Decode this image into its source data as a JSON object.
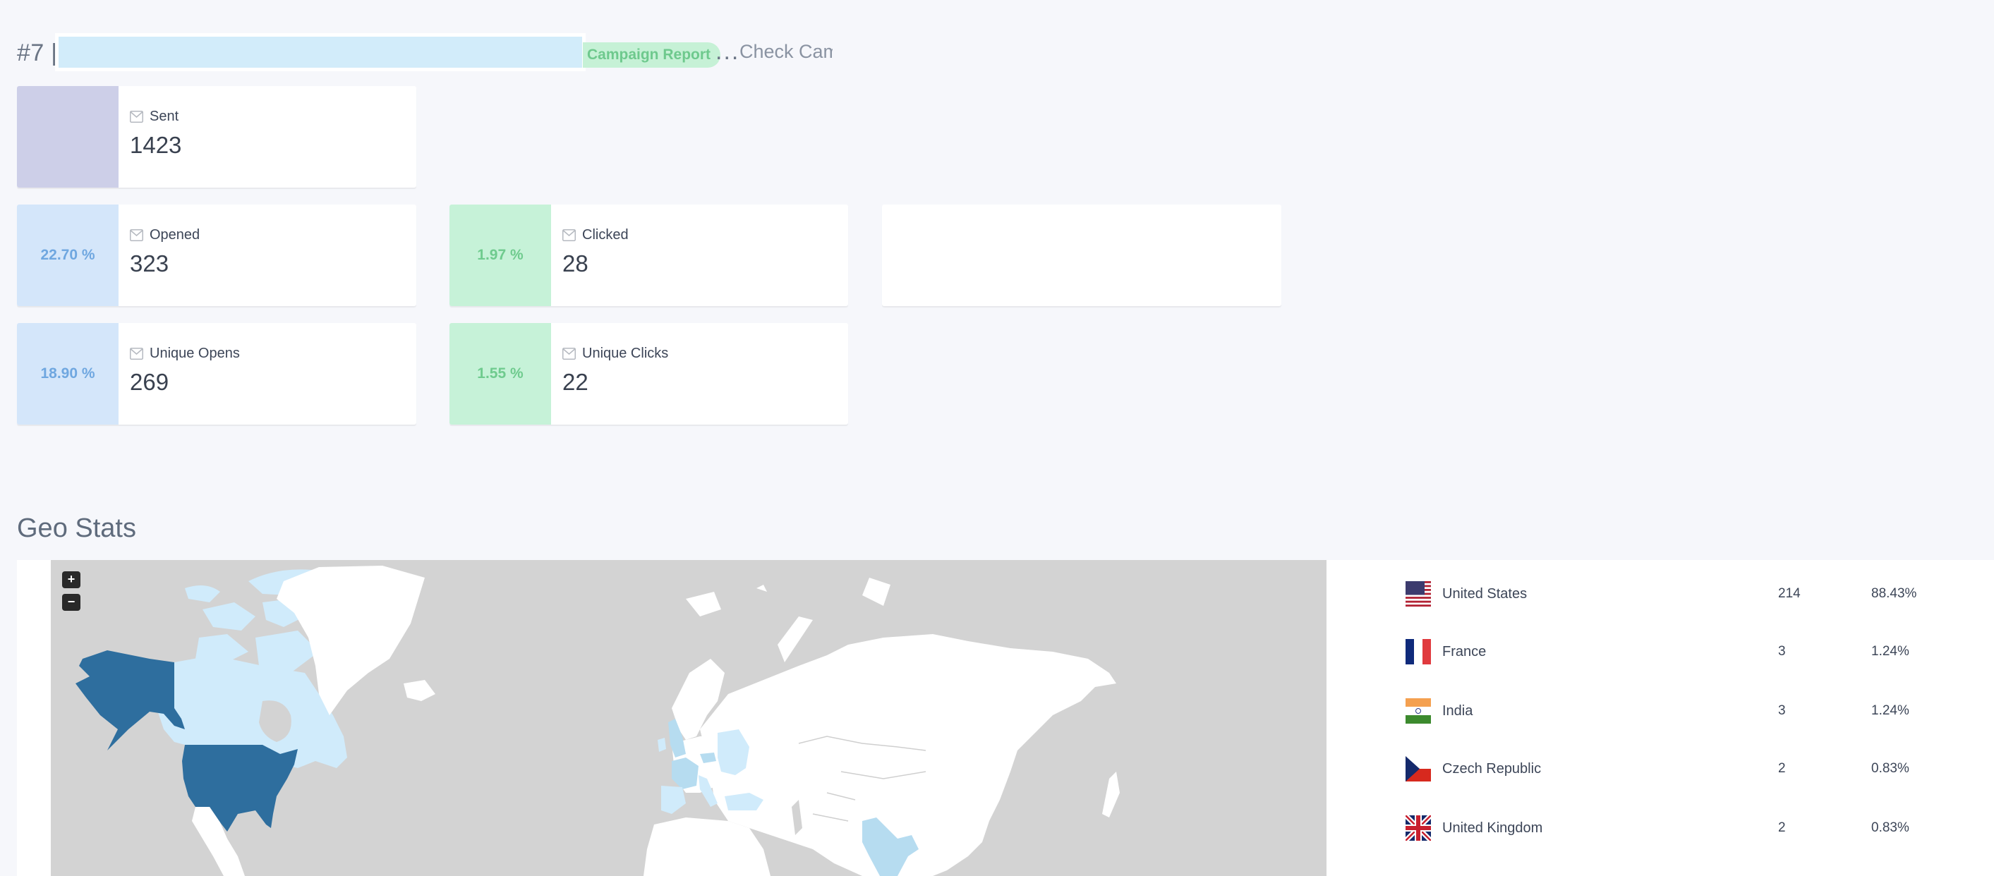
{
  "header": {
    "title_prefix": "#7 [",
    "badge": "Campaign Report",
    "more": "...",
    "check_link": "Check Campaign"
  },
  "stats": {
    "sent": {
      "label": "Sent",
      "value": "1423",
      "icon": "envelope-icon"
    },
    "opened": {
      "label": "Opened",
      "value": "323",
      "rate": "22.70 %",
      "icon": "envelope-icon"
    },
    "clicked": {
      "label": "Clicked",
      "value": "28",
      "rate": "1.97 %",
      "icon": "envelope-icon"
    },
    "unique_opens": {
      "label": "Unique Opens",
      "value": "269",
      "rate": "18.90 %",
      "icon": "envelope-icon"
    },
    "unique_clicks": {
      "label": "Unique Clicks",
      "value": "22",
      "rate": "1.55 %",
      "icon": "envelope-icon"
    }
  },
  "colors": {
    "sent_accent": "#cdcfe8",
    "open_accent": "#d4e6fa",
    "open_text": "#6fa7e0",
    "click_accent": "#c6f2d8",
    "click_text": "#6fcb8e",
    "map_high": "#2e6e9e",
    "map_mid": "#b6dcf0",
    "map_low": "#d0ebfb",
    "map_none": "#ffffff",
    "map_ocean": "#d3d3d3"
  },
  "geo": {
    "title": "Geo Stats",
    "zoom_in": "+",
    "zoom_out": "−",
    "countries": [
      {
        "name": "United States",
        "count": "214",
        "percent": "88.43%",
        "flag": "us-flag-icon"
      },
      {
        "name": "France",
        "count": "3",
        "percent": "1.24%",
        "flag": "fr-flag-icon"
      },
      {
        "name": "India",
        "count": "3",
        "percent": "1.24%",
        "flag": "in-flag-icon"
      },
      {
        "name": "Czech Republic",
        "count": "2",
        "percent": "0.83%",
        "flag": "cz-flag-icon"
      },
      {
        "name": "United Kingdom",
        "count": "2",
        "percent": "0.83%",
        "flag": "gb-flag-icon"
      }
    ]
  }
}
